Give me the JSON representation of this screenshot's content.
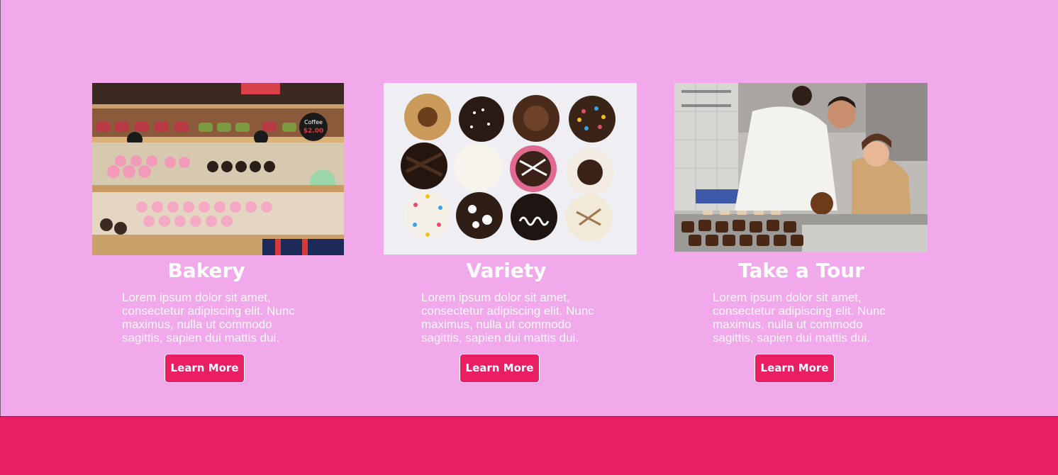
{
  "features": {
    "cards": [
      {
        "title": "Bakery",
        "description": "Lorem ipsum dolor sit amet, consectetur adipiscing elit. Nunc maximus, nulla ut commodo sagittis, sapien dui mattis dui.",
        "button_label": "Learn More",
        "image": "bakery-display-case-photo"
      },
      {
        "title": "Variety",
        "description": "Lorem ipsum dolor sit amet, consectetur adipiscing elit. Nunc maximus, nulla ut commodo sagittis, sapien dui mattis dui.",
        "button_label": "Learn More",
        "image": "cupcake-variety-photo"
      },
      {
        "title": "Take a Tour",
        "description": "Lorem ipsum dolor sit amet, consectetur adipiscing elit. Nunc maximus, nulla ut commodo sagittis, sapien dui mattis dui.",
        "button_label": "Learn More",
        "image": "kitchen-tour-photo"
      }
    ]
  },
  "colors": {
    "section_background": "#f1a9ec",
    "accent": "#e91e63",
    "text": "#ffffff"
  }
}
